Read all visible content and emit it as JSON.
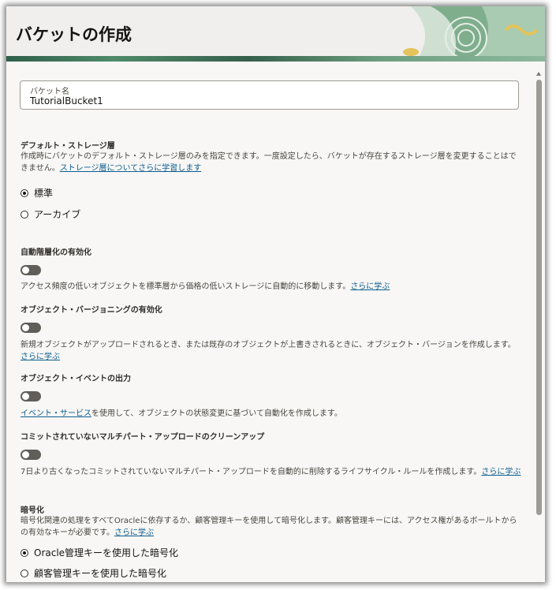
{
  "page": {
    "title": "バケットの作成"
  },
  "bucket_name": {
    "label": "バケット名",
    "value": "TutorialBucket1"
  },
  "storage_tier": {
    "label": "デフォルト・ストレージ層",
    "help": "作成時にバケットのデフォルト・ストレージ層のみを指定できます。一度設定したら、バケットが存在するストレージ層を変更することはできません。",
    "link": "ストレージ層についてさらに学習します",
    "options": [
      {
        "label": "標準",
        "selected": true
      },
      {
        "label": "アーカイブ",
        "selected": false
      }
    ]
  },
  "auto_tiering": {
    "label": "自動階層化の有効化",
    "enabled": false,
    "help": "アクセス頻度の低いオブジェクトを標準層から価格の低いストレージに自動的に移動します。",
    "link": "さらに学ぶ"
  },
  "versioning": {
    "label": "オブジェクト・バージョニングの有効化",
    "enabled": false,
    "help": "新規オブジェクトがアップロードされるとき、または既存のオブジェクトが上書きされるときに、オブジェクト・バージョンを作成します。",
    "link": "さらに学ぶ"
  },
  "events": {
    "label": "オブジェクト・イベントの出力",
    "enabled": false,
    "link": "イベント・サービス",
    "help": "を使用して、オブジェクトの状態変更に基づいて自動化を作成します。"
  },
  "multipart": {
    "label": "コミットされていないマルチパート・アップロードのクリーンアップ",
    "enabled": false,
    "help": "7日より古くなったコミットされていないマルチパート・アップロードを自動的に削除するライフサイクル・ルールを作成します。",
    "link": "さらに学ぶ"
  },
  "encryption": {
    "label": "暗号化",
    "help": "暗号化関連の処理をすべてOracleに依存するか、顧客管理キーを使用して暗号化します。顧客管理キーには、アクセス権があるボールトからの有効なキーが必要です。",
    "link": "さらに学ぶ",
    "options": [
      {
        "label": "Oracle管理キーを使用した暗号化",
        "selected": true
      },
      {
        "label": "顧客管理キーを使用した暗号化",
        "selected": false
      }
    ]
  }
}
